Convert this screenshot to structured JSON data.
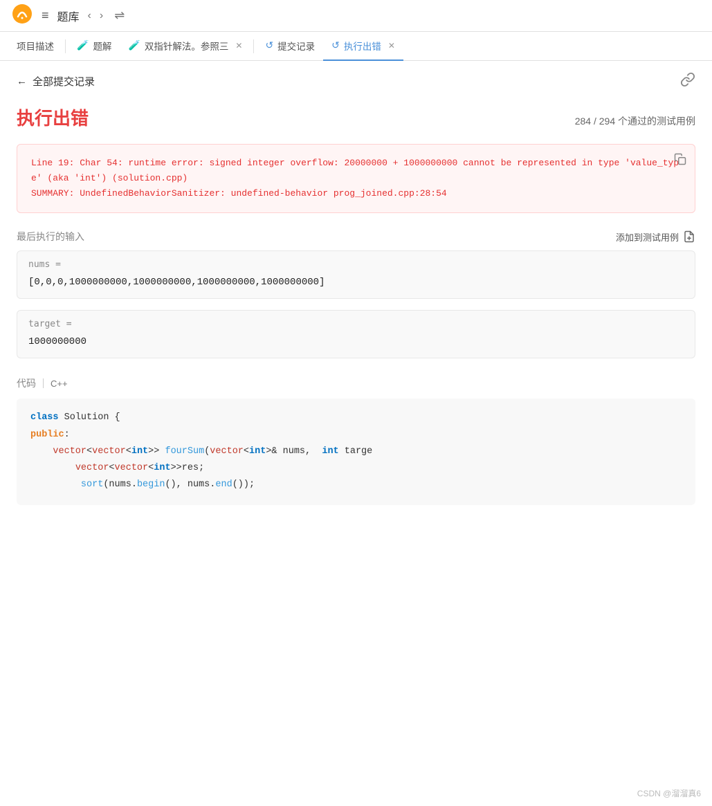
{
  "nav": {
    "logo_alt": "LeetCode",
    "list_icon": "≡",
    "label": "题库",
    "prev_arrow": "‹",
    "next_arrow": "›",
    "shuffle_icon": "⇌"
  },
  "tabs": [
    {
      "id": "description",
      "label": "项目描述",
      "icon": "",
      "active": false,
      "closable": false
    },
    {
      "id": "solution",
      "label": "题解",
      "icon": "🧪",
      "active": false,
      "closable": false
    },
    {
      "id": "two-pointer",
      "label": "双指针解法。参照三",
      "icon": "🧪",
      "active": false,
      "closable": true
    },
    {
      "id": "submissions",
      "label": "提交记录",
      "icon": "↺",
      "active": false,
      "closable": false
    },
    {
      "id": "runtime-error",
      "label": "执行出错",
      "icon": "↺",
      "active": true,
      "closable": true
    }
  ],
  "back": {
    "arrow": "←",
    "label": "全部提交记录",
    "link_icon": "🔗"
  },
  "error": {
    "title": "执行出错",
    "test_count": "284 / 294  个通过的测试用例",
    "message": "Line 19: Char 54: runtime error: signed integer overflow: 20000000 + 1000000000 cannot be represented in type 'value_type' (aka 'int') (solution.cpp)\nSUMMARY: UndefinedBehaviorSanitizer: undefined-behavior prog_joined.cpp:28:54",
    "copy_icon": "⧉"
  },
  "last_input": {
    "section_label": "最后执行的输入",
    "add_test_label": "添加到测试用例",
    "add_icon": "📋",
    "fields": [
      {
        "label": "nums =",
        "value": "[0,0,0,1000000000,1000000000,1000000000,1000000000]"
      },
      {
        "label": "target =",
        "value": "1000000000"
      }
    ]
  },
  "code_section": {
    "label": "代码",
    "separator": "|",
    "lang": "C++",
    "lines": [
      {
        "content": "class Solution {",
        "parts": [
          {
            "text": "class",
            "style": "kw"
          },
          {
            "text": " Solution {",
            "style": "plain"
          }
        ]
      },
      {
        "content": "public:",
        "parts": [
          {
            "text": "public",
            "style": "kw-orange"
          },
          {
            "text": ":",
            "style": "plain"
          }
        ]
      },
      {
        "content": "    vector<vector<int>> fourSum(vector<int>& nums,  int targe",
        "parts": [
          {
            "text": "    "
          },
          {
            "text": "vector",
            "style": "type"
          },
          {
            "text": "<",
            "style": "plain"
          },
          {
            "text": "vector",
            "style": "type"
          },
          {
            "text": "<",
            "style": "plain"
          },
          {
            "text": "int",
            "style": "kw"
          },
          {
            "text": ">> ",
            "style": "plain"
          },
          {
            "text": "fourSum",
            "style": "fn"
          },
          {
            "text": "(",
            "style": "plain"
          },
          {
            "text": "vector",
            "style": "type"
          },
          {
            "text": "<",
            "style": "plain"
          },
          {
            "text": "int",
            "style": "kw"
          },
          {
            "text": ">& nums,  ",
            "style": "plain"
          },
          {
            "text": "int",
            "style": "kw"
          },
          {
            "text": " targe",
            "style": "plain"
          }
        ]
      },
      {
        "content": "        vector<vector<int>>res;",
        "parts": [
          {
            "text": "        "
          },
          {
            "text": "vector",
            "style": "type"
          },
          {
            "text": "<",
            "style": "plain"
          },
          {
            "text": "vector",
            "style": "type"
          },
          {
            "text": "<",
            "style": "plain"
          },
          {
            "text": "int",
            "style": "kw"
          },
          {
            "text": ">>res;",
            "style": "plain"
          }
        ]
      },
      {
        "content": "         sort(nums.begin(), nums.end());",
        "parts": [
          {
            "text": "         "
          },
          {
            "text": "sort",
            "style": "fn"
          },
          {
            "text": "(nums.",
            "style": "plain"
          },
          {
            "text": "begin",
            "style": "fn"
          },
          {
            "text": "(), nums.",
            "style": "plain"
          },
          {
            "text": "end",
            "style": "fn"
          },
          {
            "text": "());",
            "style": "plain"
          }
        ]
      }
    ]
  },
  "watermark": "CSDN @溜溜真6"
}
